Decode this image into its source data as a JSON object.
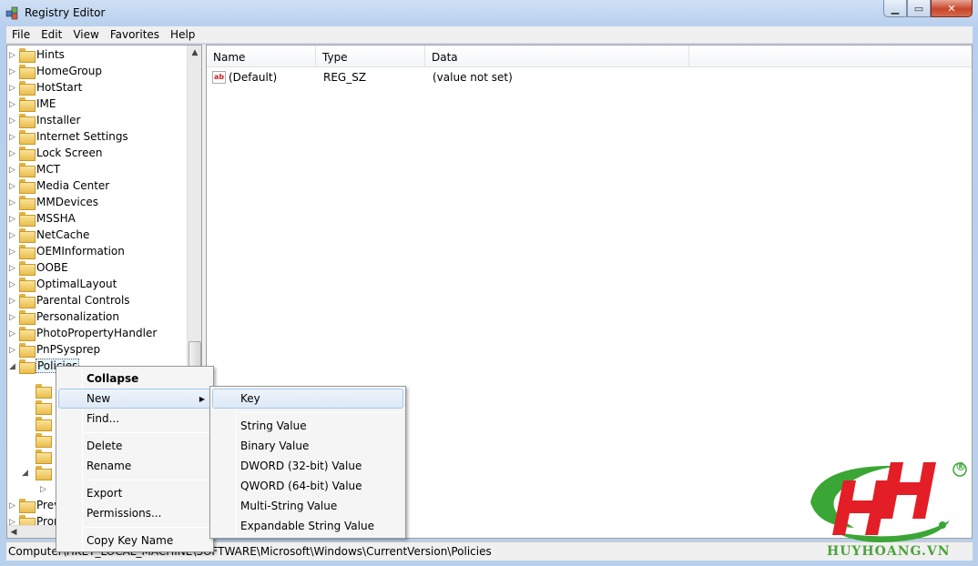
{
  "window": {
    "title": "Registry Editor"
  },
  "caption": {
    "minimize": "▁",
    "maximize": "▭",
    "close": "✕"
  },
  "menu": [
    "File",
    "Edit",
    "View",
    "Favorites",
    "Help"
  ],
  "tree": [
    {
      "label": "Hints"
    },
    {
      "label": "HomeGroup"
    },
    {
      "label": "HotStart"
    },
    {
      "label": "IME"
    },
    {
      "label": "Installer"
    },
    {
      "label": "Internet Settings"
    },
    {
      "label": "Lock Screen"
    },
    {
      "label": "MCT"
    },
    {
      "label": "Media Center"
    },
    {
      "label": "MMDevices"
    },
    {
      "label": "MSSHA"
    },
    {
      "label": "NetCache"
    },
    {
      "label": "OEMInformation"
    },
    {
      "label": "OOBE"
    },
    {
      "label": "OptimalLayout"
    },
    {
      "label": "Parental Controls"
    },
    {
      "label": "Personalization"
    },
    {
      "label": "PhotoPropertyHandler"
    },
    {
      "label": "PnPSysprep"
    },
    {
      "label": "Policies"
    }
  ],
  "tree_partial": {
    "prev": "Prev",
    "prop": "Prop"
  },
  "columns": {
    "name": "Name",
    "type": "Type",
    "data": "Data"
  },
  "values": [
    {
      "name": "(Default)",
      "type": "REG_SZ",
      "data": "(value not set)",
      "icon": "string-value-icon"
    }
  ],
  "status": "Computer\\HKEY_LOCAL_MACHINE\\SOFTWARE\\Microsoft\\Windows\\CurrentVersion\\Policies",
  "context_menu": {
    "collapse": "Collapse",
    "new": "New",
    "find": "Find...",
    "delete": "Delete",
    "rename": "Rename",
    "export": "Export",
    "permissions": "Permissions...",
    "copy_key_name": "Copy Key Name"
  },
  "new_submenu": {
    "key": "Key",
    "string_value": "String Value",
    "binary_value": "Binary Value",
    "dword": "DWORD (32-bit) Value",
    "qword": "QWORD (64-bit) Value",
    "multi_string": "Multi-String Value",
    "expandable_string": "Expandable String Value"
  },
  "watermark": {
    "text": "HUYHOANG.VN",
    "registered": "®",
    "colors": {
      "red": "#e41e26",
      "green": "#3aa635"
    }
  }
}
